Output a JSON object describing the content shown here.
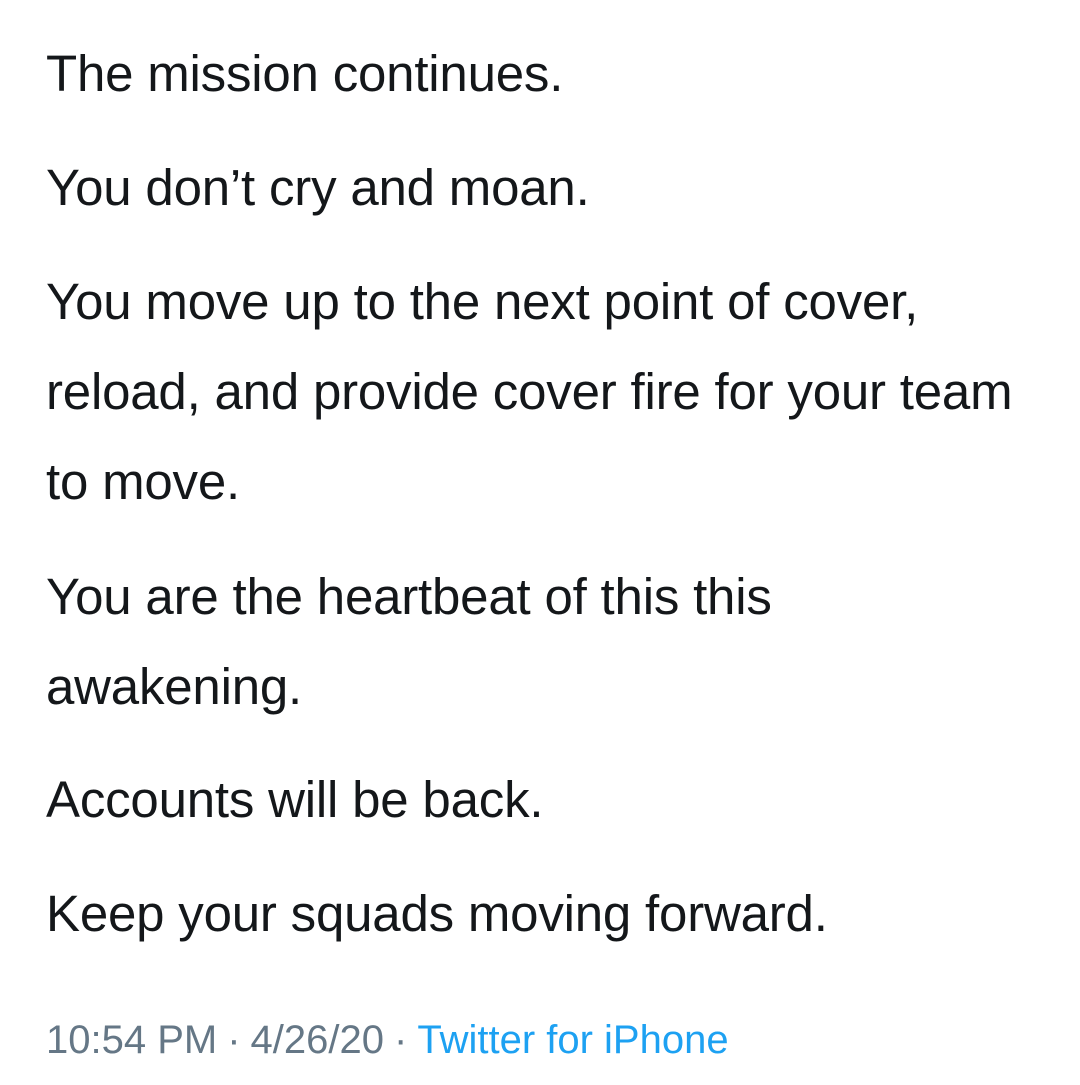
{
  "tweet": {
    "paragraphs": [
      "The mission continues.",
      "You don’t cry and moan.",
      "You move up to the next point of cover, reload, and provide cover fire for your team to move.",
      "You are the heartbeat of this this awakening.",
      "Accounts will be back.",
      "Keep your squads moving forward."
    ],
    "time": "10:54 PM",
    "date": "4/26/20",
    "separator": "·",
    "source": "Twitter for iPhone"
  },
  "colors": {
    "text": "#14171a",
    "meta": "#657786",
    "link": "#1da1f2",
    "background": "#ffffff"
  }
}
